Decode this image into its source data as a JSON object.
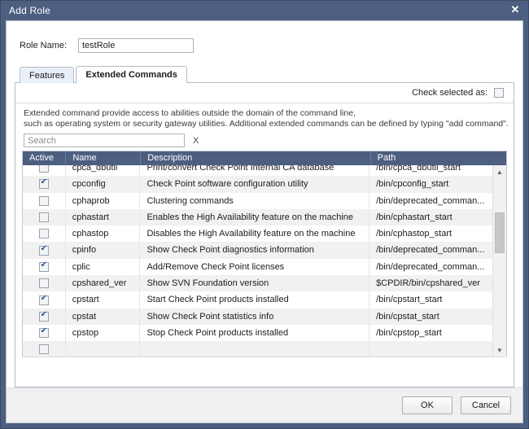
{
  "window": {
    "title": "Add Role",
    "close_icon": "close-icon"
  },
  "form": {
    "role_name_label": "Role Name:",
    "role_name_value": "testRole",
    "role_name_placeholder": ""
  },
  "tabs": [
    {
      "label": "Features",
      "active": false
    },
    {
      "label": "Extended Commands",
      "active": true
    }
  ],
  "panel": {
    "check_selected_label": "Check selected as:",
    "check_selected_checked": false,
    "help_line_1": "Extended command provide access to abilities outside the domain of the command line,",
    "help_line_2": "such as operating system or security gateway utilities. Additional extended commands can be defined by typing \"add command\".",
    "search_placeholder": "Search",
    "search_value": "",
    "clear_search_label": "X"
  },
  "table": {
    "columns": [
      "Active",
      "Name",
      "Description",
      "Path"
    ],
    "rows": [
      {
        "active": false,
        "name": "cpca_dbutil",
        "description": "Print/convert Check Point Internal CA database",
        "path": "/bin/cpca_dbutil_start"
      },
      {
        "active": true,
        "name": "cpconfig",
        "description": "Check Point software configuration utility",
        "path": "/bin/cpconfig_start"
      },
      {
        "active": false,
        "name": "cphaprob",
        "description": "Clustering commands",
        "path": "/bin/deprecated_comman..."
      },
      {
        "active": false,
        "name": "cphastart",
        "description": "Enables the High Availability feature on the machine",
        "path": "/bin/cphastart_start"
      },
      {
        "active": false,
        "name": "cphastop",
        "description": "Disables the High Availability feature on the machine",
        "path": "/bin/cphastop_start"
      },
      {
        "active": true,
        "name": "cpinfo",
        "description": "Show Check Point diagnostics information",
        "path": "/bin/deprecated_comman..."
      },
      {
        "active": true,
        "name": "cplic",
        "description": "Add/Remove Check Point licenses",
        "path": "/bin/deprecated_comman..."
      },
      {
        "active": false,
        "name": "cpshared_ver",
        "description": "Show SVN Foundation version",
        "path": "$CPDIR/bin/cpshared_ver"
      },
      {
        "active": true,
        "name": "cpstart",
        "description": "Start Check Point products installed",
        "path": "/bin/cpstart_start"
      },
      {
        "active": true,
        "name": "cpstat",
        "description": "Show Check Point statistics info",
        "path": "/bin/cpstat_start"
      },
      {
        "active": true,
        "name": "cpstop",
        "description": "Stop Check Point products installed",
        "path": "/bin/cpstop_start"
      },
      {
        "active": false,
        "name": "",
        "description": "",
        "path": ""
      }
    ],
    "scroll_up_icon": "▲",
    "scroll_down_icon": "▼"
  },
  "footer": {
    "ok_label": "OK",
    "cancel_label": "Cancel"
  },
  "colors": {
    "titlebar": "#4d5f80",
    "header_row": "#4d5f80",
    "tab_inactive": "#e9eff7",
    "row_alt": "#f1f1f1",
    "check_mark": "#2b579a"
  }
}
